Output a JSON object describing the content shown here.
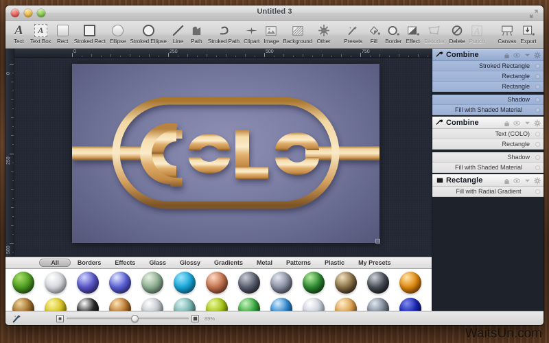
{
  "window": {
    "title": "Untitled 3",
    "controls": {
      "close": "close",
      "minimize": "minimize",
      "maximize": "maximize"
    }
  },
  "toolbar": {
    "items": [
      {
        "label": "Text",
        "icon": "text-icon",
        "enabled": true
      },
      {
        "label": "Text Box",
        "icon": "text-box-icon",
        "enabled": true
      },
      {
        "label": "Rect",
        "icon": "rect-icon",
        "enabled": true
      },
      {
        "label": "Stroked Rect",
        "icon": "stroked-rect-icon",
        "enabled": true
      },
      {
        "label": "Ellipse",
        "icon": "ellipse-icon",
        "enabled": true
      },
      {
        "label": "Stroked Ellipse",
        "icon": "stroked-ellipse-icon",
        "enabled": true
      },
      {
        "label": "Line",
        "icon": "line-icon",
        "enabled": true
      },
      {
        "label": "Path",
        "icon": "path-icon",
        "enabled": true
      },
      {
        "label": "Stroked Path",
        "icon": "stroked-path-icon",
        "enabled": true
      },
      {
        "label": "Clipart",
        "icon": "clipart-icon",
        "enabled": true
      },
      {
        "label": "Image",
        "icon": "image-icon",
        "enabled": true
      },
      {
        "label": "Background",
        "icon": "background-icon",
        "enabled": true
      },
      {
        "label": "Other",
        "icon": "other-icon",
        "enabled": true
      },
      {
        "label": "Presets",
        "icon": "presets-icon",
        "enabled": true
      },
      {
        "label": "Fill",
        "icon": "fill-icon",
        "enabled": true
      },
      {
        "label": "Border",
        "icon": "border-icon",
        "enabled": true
      },
      {
        "label": "Effect",
        "icon": "effect-icon",
        "enabled": true
      },
      {
        "label": "Distorter",
        "icon": "distorter-icon",
        "enabled": false
      },
      {
        "label": "Delete",
        "icon": "delete-icon",
        "enabled": true
      },
      {
        "label": "Punch",
        "icon": "punch-icon",
        "enabled": false
      },
      {
        "label": "Canvas",
        "icon": "canvas-icon",
        "enabled": true
      },
      {
        "label": "Export",
        "icon": "export-icon",
        "enabled": true
      }
    ]
  },
  "rulers": {
    "horizontal_ticks": [
      "0",
      "250",
      "500",
      "750"
    ],
    "vertical_ticks": [
      "0",
      "250"
    ]
  },
  "canvas": {
    "artwork_text": "COLO",
    "gold_light": "#f6dcab",
    "gold_mid": "#d9a867",
    "gold_dark": "#8a5f2c",
    "board_bg": "#7d80a6"
  },
  "inspector": {
    "groups": [
      {
        "title": "Combine",
        "icon": "combine-icon",
        "selected": true,
        "controls": [
          "lock-icon",
          "eye-icon",
          "chevron-down-icon",
          "gear-icon"
        ],
        "rows": [
          {
            "label": "Stroked Rectangle",
            "spaced": false,
            "center": false
          },
          {
            "label": "Rectangle",
            "spaced": false,
            "center": false
          },
          {
            "label": "Rectangle",
            "spaced": false,
            "center": false
          },
          {
            "label": "Shadow",
            "spaced": true,
            "center": false
          },
          {
            "label": "Fill with Shaded Material",
            "spaced": false,
            "center": true
          }
        ]
      },
      {
        "title": "Combine",
        "icon": "combine-icon",
        "selected": false,
        "controls": [
          "lock-icon",
          "eye-icon",
          "chevron-down-icon",
          "gear-icon"
        ],
        "rows": [
          {
            "label": "Text (COLO)",
            "spaced": false,
            "center": false
          },
          {
            "label": "Rectangle",
            "spaced": false,
            "center": false
          },
          {
            "label": "Shadow",
            "spaced": true,
            "center": false
          },
          {
            "label": "Fill with Shaded Material",
            "spaced": false,
            "center": true
          }
        ]
      },
      {
        "title": "Rectangle",
        "icon": "rectangle-icon",
        "selected": false,
        "controls": [
          "lock-icon",
          "eye-icon",
          "chevron-down-icon",
          "gear-icon"
        ],
        "rows": [
          {
            "label": "Fill with Radial Gradient",
            "spaced": false,
            "center": true
          }
        ]
      }
    ]
  },
  "browser": {
    "tabs": [
      {
        "label": "All",
        "active": true
      },
      {
        "label": "Borders",
        "active": false
      },
      {
        "label": "Effects",
        "active": false
      },
      {
        "label": "Glass",
        "active": false
      },
      {
        "label": "Glossy",
        "active": false
      },
      {
        "label": "Gradients",
        "active": false
      },
      {
        "label": "Metal",
        "active": false
      },
      {
        "label": "Patterns",
        "active": false
      },
      {
        "label": "Plastic",
        "active": false
      },
      {
        "label": "My Presets",
        "active": false
      }
    ],
    "swatch_rows": [
      [
        {
          "name": "green-glossy",
          "c1": "#a8e06a",
          "c2": "#4f9e22",
          "c3": "#17470a"
        },
        {
          "name": "white-pearl",
          "c1": "#ffffff",
          "c2": "#d7d9de",
          "c3": "#9a9ea8"
        },
        {
          "name": "indigo-glass",
          "c1": "#cfd6ff",
          "c2": "#5a56c8",
          "c3": "#2b2470"
        },
        {
          "name": "blue-glass",
          "c1": "#e2e8ff",
          "c2": "#5b62d6",
          "c3": "#2a2a82"
        },
        {
          "name": "sage-glass",
          "c1": "#e8f2e2",
          "c2": "#8fb094",
          "c3": "#4f6b55"
        },
        {
          "name": "cyan-orb",
          "c1": "#9be6ff",
          "c2": "#19a7d8",
          "c3": "#0a5f86"
        },
        {
          "name": "copper-metal",
          "c1": "#ffd9c2",
          "c2": "#c47450",
          "c3": "#6d3420"
        },
        {
          "name": "steel-dark",
          "c1": "#c9ccd6",
          "c2": "#5b6070",
          "c3": "#1d2029"
        },
        {
          "name": "silver-blue",
          "c1": "#e3e8f2",
          "c2": "#8d93a4",
          "c3": "#3a3f4d"
        },
        {
          "name": "green-metal",
          "c1": "#b4eda0",
          "c2": "#2e8a32",
          "c3": "#0d3310"
        },
        {
          "name": "bronze-dark",
          "c1": "#f3e0bd",
          "c2": "#8a7248",
          "c3": "#22180c"
        },
        {
          "name": "black-chrome",
          "c1": "#cfd3da",
          "c2": "#4a4f58",
          "c3": "#0b0c10"
        },
        {
          "name": "amber-orange",
          "c1": "#ffe6a8",
          "c2": "#e08a12",
          "c3": "#7a3d02"
        }
      ],
      [
        {
          "name": "brown-small",
          "c1": "#f0d49b",
          "c2": "#a0702c",
          "c3": "#3d2207"
        },
        {
          "name": "gold-yellow",
          "c1": "#fbf7a8",
          "c2": "#d8c423",
          "c3": "#6d6104"
        },
        {
          "name": "black-white",
          "c1": "#ffffff",
          "c2": "#2b2b2b",
          "c3": "#000000"
        },
        {
          "name": "copper-ball",
          "c1": "#ffe2b4",
          "c2": "#b5772d",
          "c3": "#3b1e06"
        },
        {
          "name": "silver-ball",
          "c1": "#ffffff",
          "c2": "#c4c7cd",
          "c3": "#72767e"
        },
        {
          "name": "teal-satin",
          "c1": "#d9f4f2",
          "c2": "#79b3ae",
          "c3": "#2f5a58"
        },
        {
          "name": "lime-ball",
          "c1": "#ecf9a0",
          "c2": "#a3c313",
          "c3": "#4d5e03"
        },
        {
          "name": "emerald-ball",
          "c1": "#c8f3bd",
          "c2": "#38a83f",
          "c3": "#0f4312"
        },
        {
          "name": "azure-ball",
          "c1": "#d4ecff",
          "c2": "#2f86cc",
          "c3": "#0b3f70"
        },
        {
          "name": "pearl-ball",
          "c1": "#ffffff",
          "c2": "#cdd2dc",
          "c3": "#848a96"
        },
        {
          "name": "tan-ball",
          "c1": "#ffedc9",
          "c2": "#daa14f",
          "c3": "#6b3f13"
        },
        {
          "name": "slate-ball",
          "c1": "#dfe6ef",
          "c2": "#7b8694",
          "c3": "#2b323c"
        },
        {
          "name": "navy-ball",
          "c1": "#7f8cf0",
          "c2": "#1a24b0",
          "c3": "#05063d"
        }
      ]
    ]
  },
  "statusbar": {
    "tool_icon": "magic-wand-icon",
    "small_icon": "small-thumbnail-icon",
    "large_icon": "large-thumbnail-icon",
    "zoom_value": "89%"
  },
  "watermark": {
    "text": "WaitsUn.com"
  }
}
